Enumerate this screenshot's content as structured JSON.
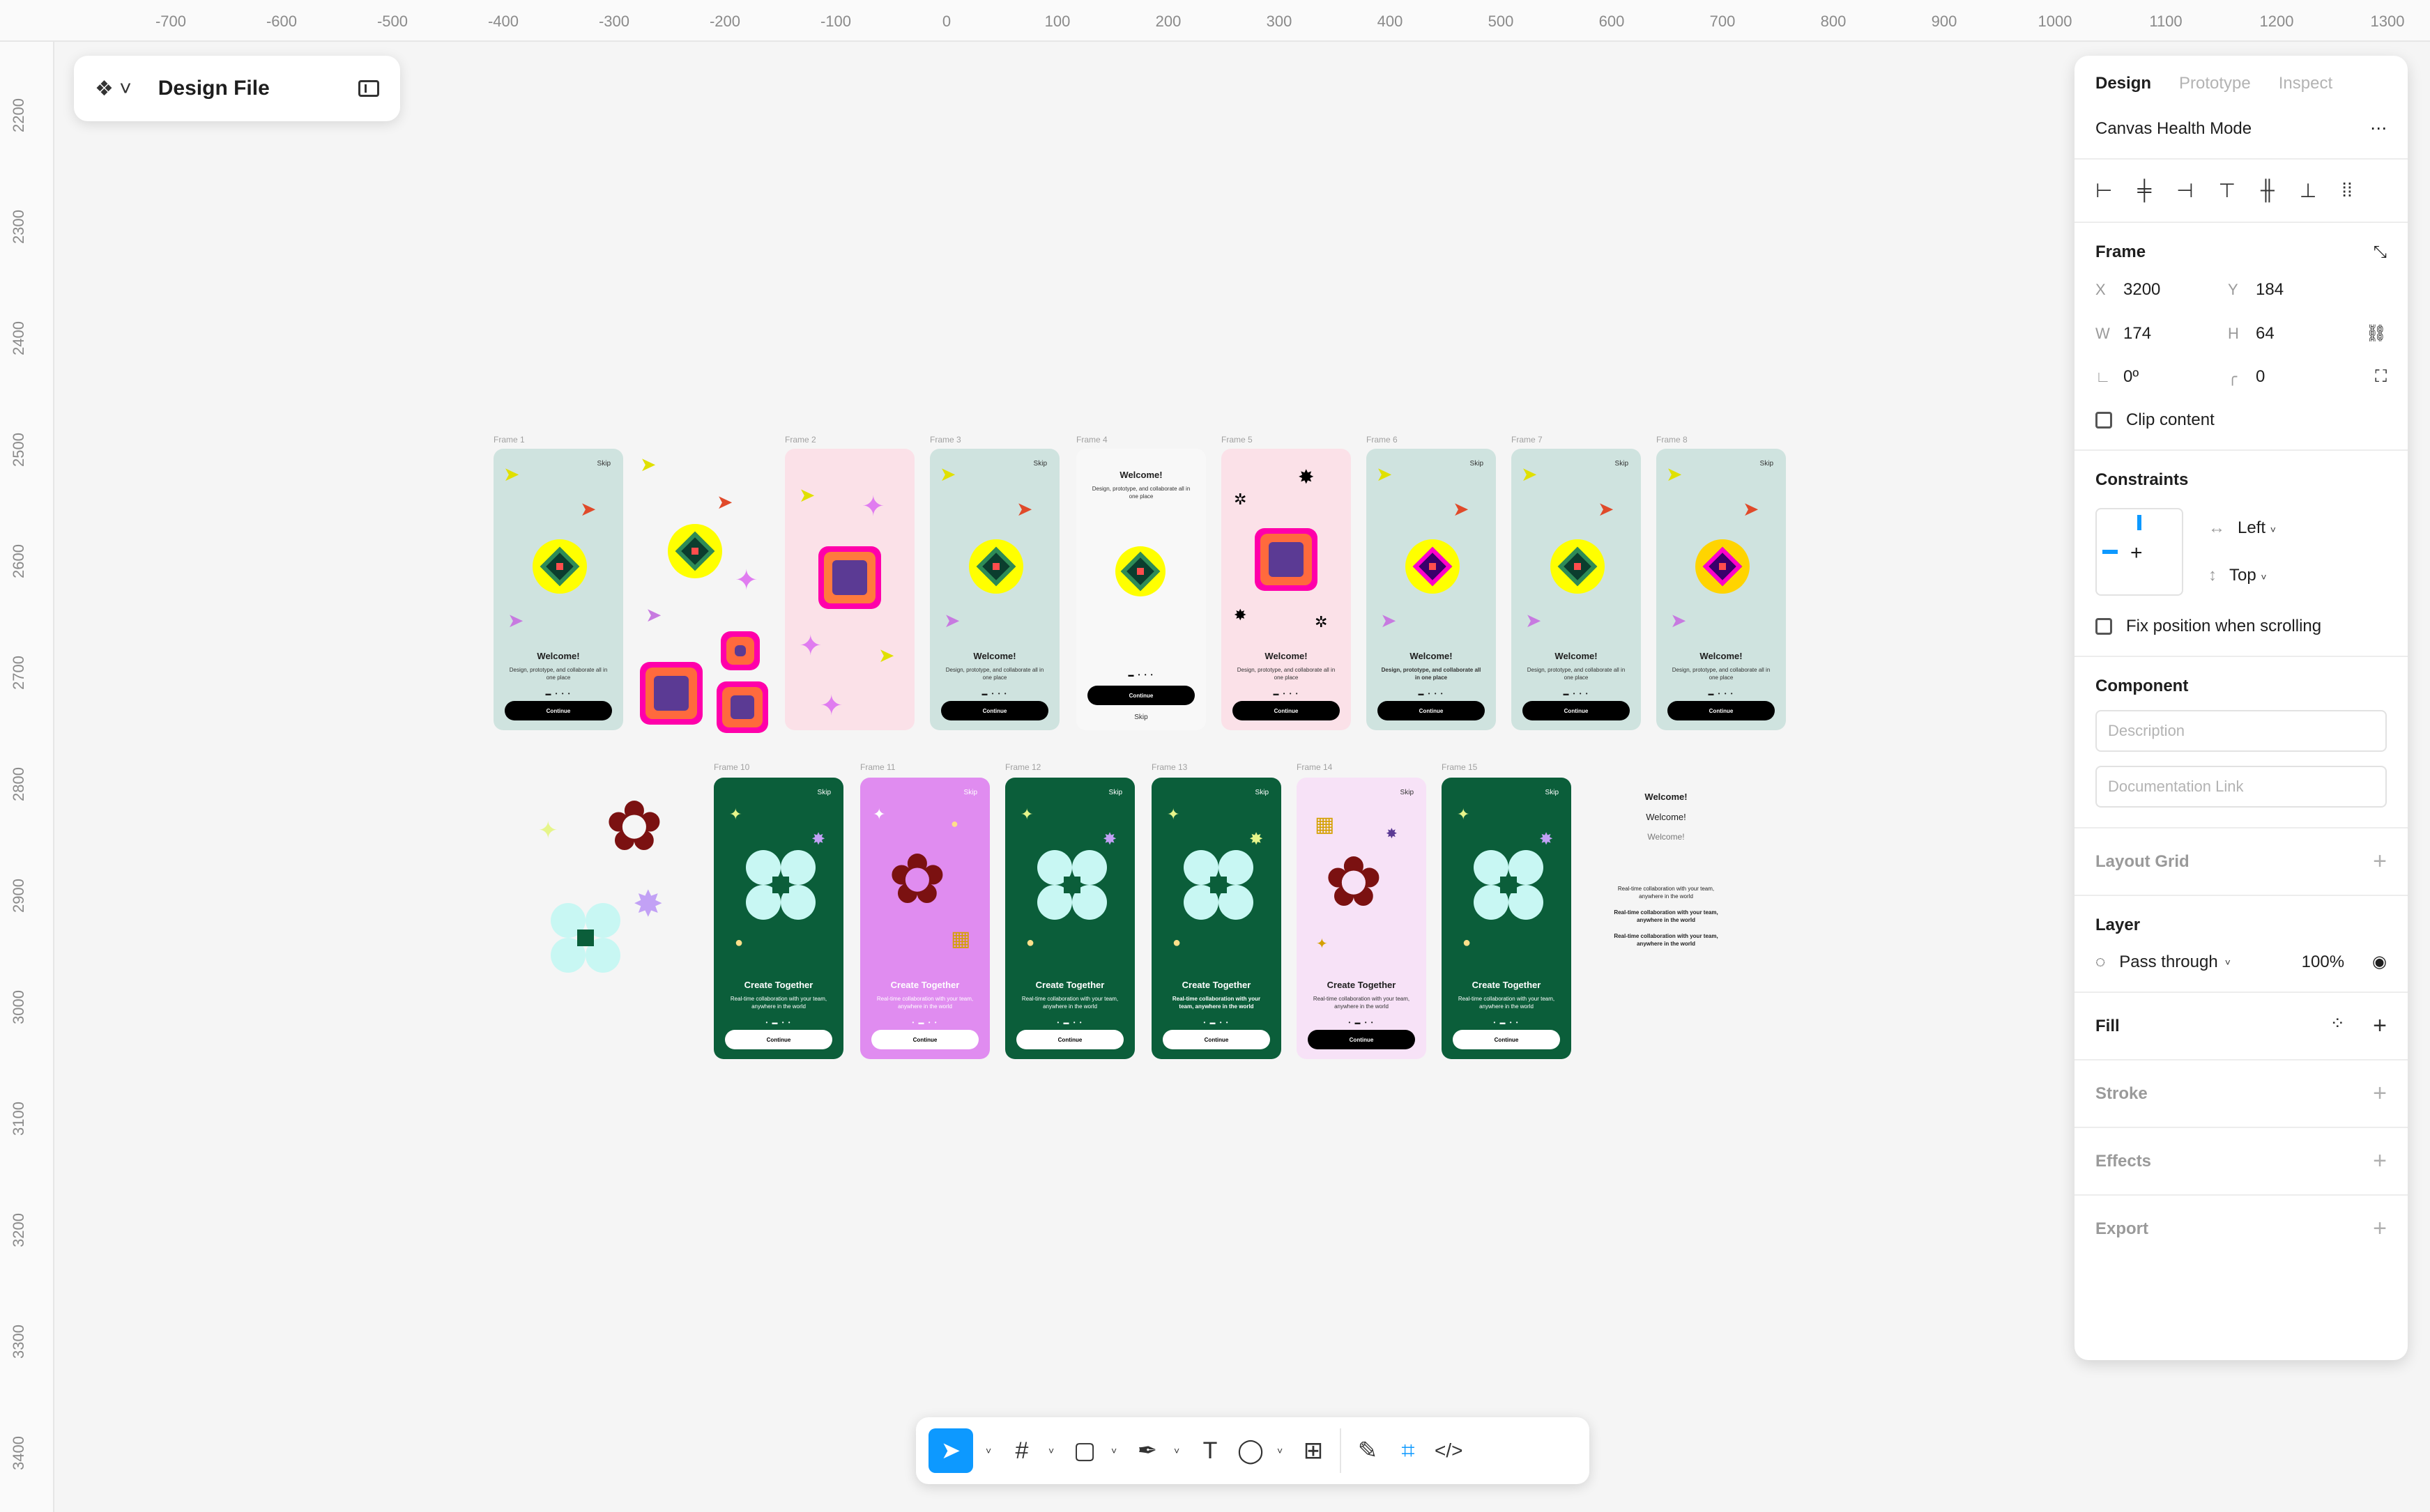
{
  "app": {
    "file_title": "Design File"
  },
  "ruler": {
    "top": [
      "-700",
      "-600",
      "-500",
      "-400",
      "-300",
      "-200",
      "-100",
      "0",
      "100",
      "200",
      "300",
      "400",
      "500",
      "600",
      "700",
      "800",
      "900",
      "1000",
      "1100",
      "1200",
      "1300"
    ],
    "left": [
      "2200",
      "2300",
      "2400",
      "2500",
      "2600",
      "2700",
      "2800",
      "2900",
      "3000",
      "3100",
      "3200",
      "3300",
      "3400"
    ]
  },
  "canvas": {
    "frames_row1": [
      "Frame 1",
      "Frame 2",
      "Frame 3",
      "Frame 4",
      "Frame 5",
      "Frame 6",
      "Frame 7",
      "Frame 8"
    ],
    "frames_row2": [
      "Frame 10",
      "Frame 11",
      "Frame 12",
      "Frame 13",
      "Frame 14",
      "Frame 15"
    ],
    "welcome_title": "Welcome!",
    "welcome_sub": "Design, prototype, and collaborate all in one place",
    "create_title": "Create Together",
    "create_sub": "Real-time collaboration with your team, anywhere in the world",
    "continue_label": "Continue",
    "skip_label": "Skip",
    "side_texts": {
      "w1": "Welcome!",
      "w2": "Welcome!",
      "w3": "Welcome!",
      "r1": "Real-time collaboration with your team, anywhere in the world",
      "r2": "Real-time collaboration with your team, anywhere in the world",
      "r3": "Real-time collaboration with your team, anywhere in the world"
    }
  },
  "panel": {
    "tabs": [
      "Design",
      "Prototype",
      "Inspect"
    ],
    "mode": "Canvas Health Mode",
    "frame_title": "Frame",
    "x": {
      "label": "X",
      "value": "3200"
    },
    "y": {
      "label": "Y",
      "value": "184"
    },
    "w": {
      "label": "W",
      "value": "174"
    },
    "h": {
      "label": "H",
      "value": "64"
    },
    "rotation": "0º",
    "radius": "0",
    "clip": "Clip content",
    "constraints": {
      "title": "Constraints",
      "h": "Left",
      "v": "Top",
      "fix": "Fix position when scrolling"
    },
    "component": {
      "title": "Component",
      "desc_ph": "Description",
      "link_ph": "Documentation Link"
    },
    "layout_grid": "Layout Grid",
    "layer": {
      "title": "Layer",
      "blend": "Pass through",
      "opacity": "100%"
    },
    "fill": "Fill",
    "stroke": "Stroke",
    "effects": "Effects",
    "export": "Export"
  },
  "colors": {
    "accent": "#0d99ff",
    "teal_bg": "#cfe3df",
    "pink_bg": "#fbe1e8",
    "green_bg": "#0b5e3a",
    "purple_bg": "#e08cf0",
    "lilac_bg": "#f7e2f7"
  }
}
